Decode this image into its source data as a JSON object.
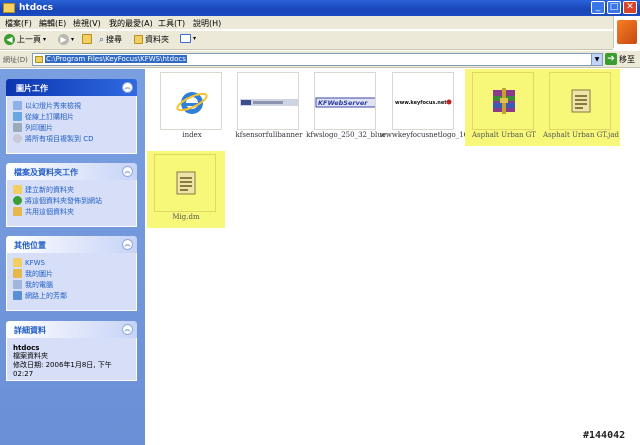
{
  "window": {
    "title": "htdocs"
  },
  "menu": [
    "檔案(F)",
    "編輯(E)",
    "檢視(V)",
    "我的最愛(A)",
    "工具(T)",
    "說明(H)"
  ],
  "toolbar": {
    "back": "上一頁",
    "search": "搜尋",
    "folders": "資料夾"
  },
  "address": {
    "label": "網址(D)",
    "path": "C:\\Program Files\\KeyFocus\\KFWS\\htdocs",
    "go": "移至"
  },
  "left_panels": {
    "picture_tasks": {
      "title": "圖片工作",
      "links": [
        "以幻燈片秀來檢視",
        "從線上訂購相片",
        "列印圖片",
        "將所有項目複製到 CD"
      ]
    },
    "file_folder_tasks": {
      "title": "檔案及資料夾工作",
      "links": [
        "建立新的資料夾",
        "將這個資料夾發佈到網站",
        "共用這個資料夾"
      ]
    },
    "other_places": {
      "title": "其他位置",
      "links": [
        "KFWS",
        "我的圖片",
        "我的電腦",
        "網路上的芳鄰"
      ]
    },
    "details": {
      "title": "詳細資料",
      "name": "htdocs",
      "type": "檔案資料夾",
      "modified": "修改日期: 2006年1月8日, 下午 02:27"
    }
  },
  "files": [
    {
      "name": "index",
      "kind": "ie",
      "selected": false
    },
    {
      "name": "kfsensorfullbanner",
      "kind": "banner",
      "selected": false
    },
    {
      "name": "kfwslogo_250_32_blue",
      "kind": "kfws",
      "selected": false
    },
    {
      "name": "wwwkeyfocusnetlogo_16",
      "kind": "kflogo",
      "selected": false
    },
    {
      "name": "Asphalt Urban GT",
      "kind": "archive",
      "selected": true
    },
    {
      "name": "Asphalt Urban GT.jad",
      "kind": "doc",
      "selected": true
    },
    {
      "name": "Mig.dm",
      "kind": "doc",
      "selected": true
    }
  ],
  "thumb_text": {
    "kfws": "KFWebServer",
    "kflogo": "www.keyfocus.net"
  },
  "watermark": "#144042"
}
